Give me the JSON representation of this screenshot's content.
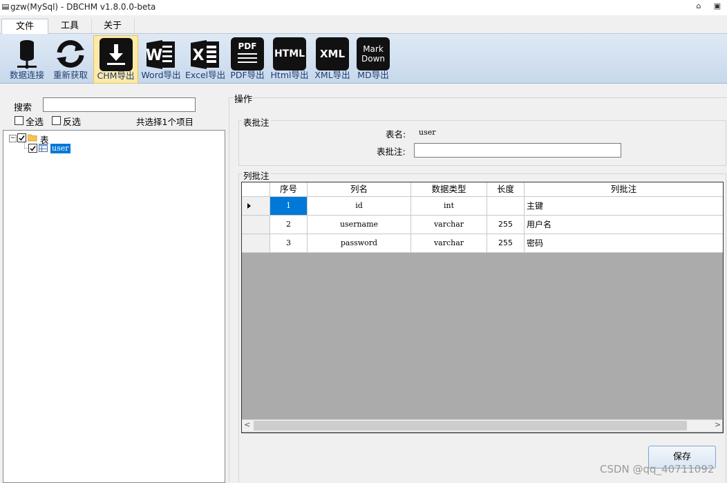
{
  "window": {
    "title": "gzw(MySql) - DBCHM v1.8.0.0-beta",
    "restore_glyph": "⌂",
    "maximize_glyph": "▣"
  },
  "ribbon": {
    "tabs": [
      {
        "label": "文件",
        "active": true
      },
      {
        "label": "工具",
        "active": false
      },
      {
        "label": "关于",
        "active": false
      }
    ],
    "buttons": [
      {
        "label": "数据连接",
        "icon": "database-connect-icon"
      },
      {
        "label": "重新获取",
        "icon": "refresh-icon"
      },
      {
        "label": "CHM导出",
        "icon": "chm-export-icon",
        "active": true
      },
      {
        "label": "Word导出",
        "icon": "word-icon",
        "icon_text": "W"
      },
      {
        "label": "Excel导出",
        "icon": "excel-icon",
        "icon_text": "X"
      },
      {
        "label": "PDF导出",
        "icon": "pdf-icon",
        "icon_text": "PDF"
      },
      {
        "label": "Html导出",
        "icon": "html-icon",
        "icon_text": "HTML"
      },
      {
        "label": "XML导出",
        "icon": "xml-icon",
        "icon_text": "XML"
      },
      {
        "label": "MD导出",
        "icon": "markdown-icon",
        "icon_text": "Mark Down"
      }
    ]
  },
  "left": {
    "search_label": "搜索",
    "search_value": "",
    "select_all_label": "全选",
    "invert_label": "反选",
    "selected_count": "共选择1个项目",
    "tree": {
      "root_label": "表",
      "children": [
        {
          "label": "user",
          "checked": true,
          "selected": true
        }
      ]
    }
  },
  "right": {
    "ops_label": "操作",
    "table_comment": {
      "group_title": "表批注",
      "table_name_label": "表名:",
      "table_name_value": "user",
      "comment_label": "表批注:",
      "comment_value": ""
    },
    "column_comment": {
      "group_title": "列批注",
      "headers": [
        "序号",
        "列名",
        "数据类型",
        "长度",
        "列批注"
      ],
      "rows": [
        {
          "index": "1",
          "name": "id",
          "type": "int",
          "length": "",
          "comment": "主键"
        },
        {
          "index": "2",
          "name": "username",
          "type": "varchar",
          "length": "255",
          "comment": "用户名"
        },
        {
          "index": "3",
          "name": "password",
          "type": "varchar",
          "length": "255",
          "comment": "密码"
        }
      ],
      "scroll_left": "<",
      "scroll_right": ">"
    },
    "save_label": "保存"
  },
  "watermark": "CSDN @qq_40711092",
  "colors": {
    "selection": "#0078d7",
    "toolbar_label": "#1c3c6e",
    "active_button": "#fde9a8"
  }
}
